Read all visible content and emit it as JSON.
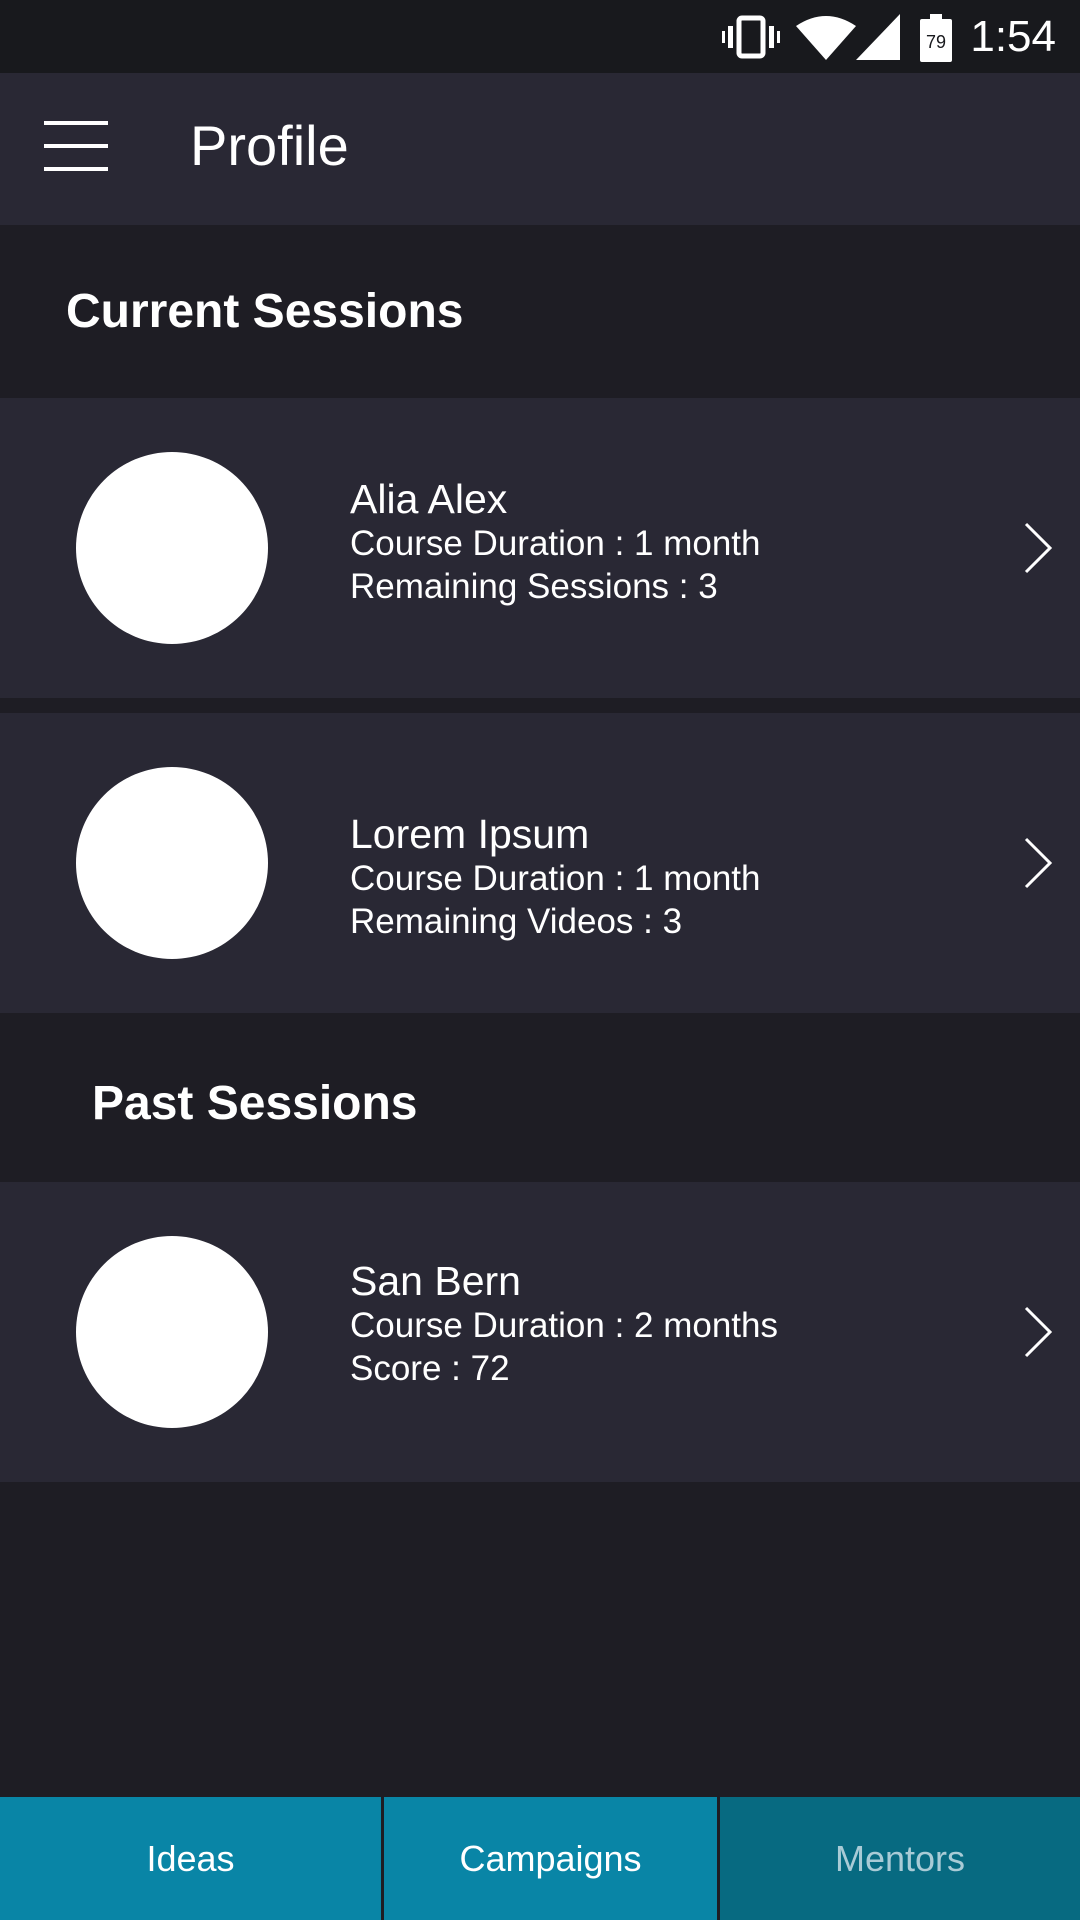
{
  "status_bar": {
    "time": "1:54",
    "battery": "79",
    "icons": [
      "vibrate-icon",
      "wifi-icon",
      "signal-icon",
      "battery-icon"
    ]
  },
  "app_bar": {
    "title": "Profile",
    "menu_icon": "hamburger-menu-icon"
  },
  "current_sessions": {
    "title": "Current Sessions",
    "items": [
      {
        "name": "Alia Alex",
        "line1": "Course Duration : 1 month",
        "line2": "Remaining Sessions : 3"
      },
      {
        "name": "Lorem Ipsum",
        "line1": "Course Duration : 1 month",
        "line2": "Remaining Videos : 3"
      }
    ]
  },
  "past_sessions": {
    "title": "Past Sessions",
    "items": [
      {
        "name": "San Bern",
        "line1": "Course Duration : 2 months",
        "line2": "Score : 72"
      }
    ]
  },
  "bottom_nav": {
    "tabs": [
      {
        "label": "Ideas",
        "active": false
      },
      {
        "label": "Campaigns",
        "active": false
      },
      {
        "label": "Mentors",
        "active": true
      }
    ]
  },
  "colors": {
    "background": "#1e1d24",
    "card": "#292834",
    "nav": "#0985a6",
    "nav_active": "#076a81"
  }
}
